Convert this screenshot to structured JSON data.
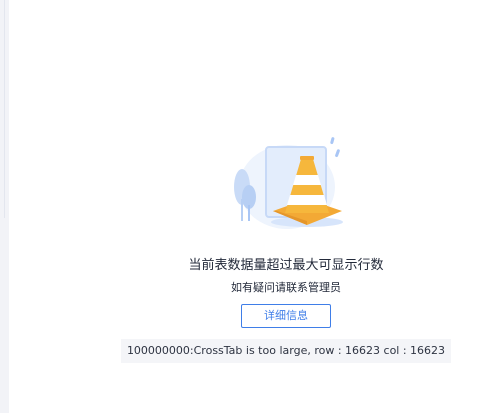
{
  "empty_state": {
    "illustration_icon": "warning-cone-icon",
    "title": "当前表数据量超过最大可显示行数",
    "subtitle": "如有疑问请联系管理员",
    "detail_button_label": "详细信息",
    "error_message": "100000000:CrossTab is too large, row : 16623 col : 16623"
  },
  "colors": {
    "accent": "#3f7ee8",
    "cone_orange": "#f6b73c",
    "illustration_blue": "#dbe8fb",
    "error_box_bg": "#f4f5f8",
    "text": "#232a3a"
  }
}
